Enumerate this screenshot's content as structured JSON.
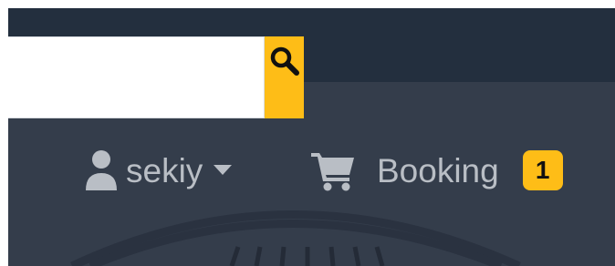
{
  "search": {
    "value": "",
    "placeholder": ""
  },
  "account": {
    "name": "sekiy"
  },
  "cart": {
    "label": "Booking",
    "count": "1"
  },
  "colors": {
    "topbar": "#232f3e",
    "navbar": "#343d4b",
    "accent": "#febd17",
    "nav_text": "#b9bec5"
  },
  "icons": {
    "search": "search-icon",
    "user": "user-icon",
    "caret": "chevron-down-icon",
    "cart": "cart-icon"
  }
}
